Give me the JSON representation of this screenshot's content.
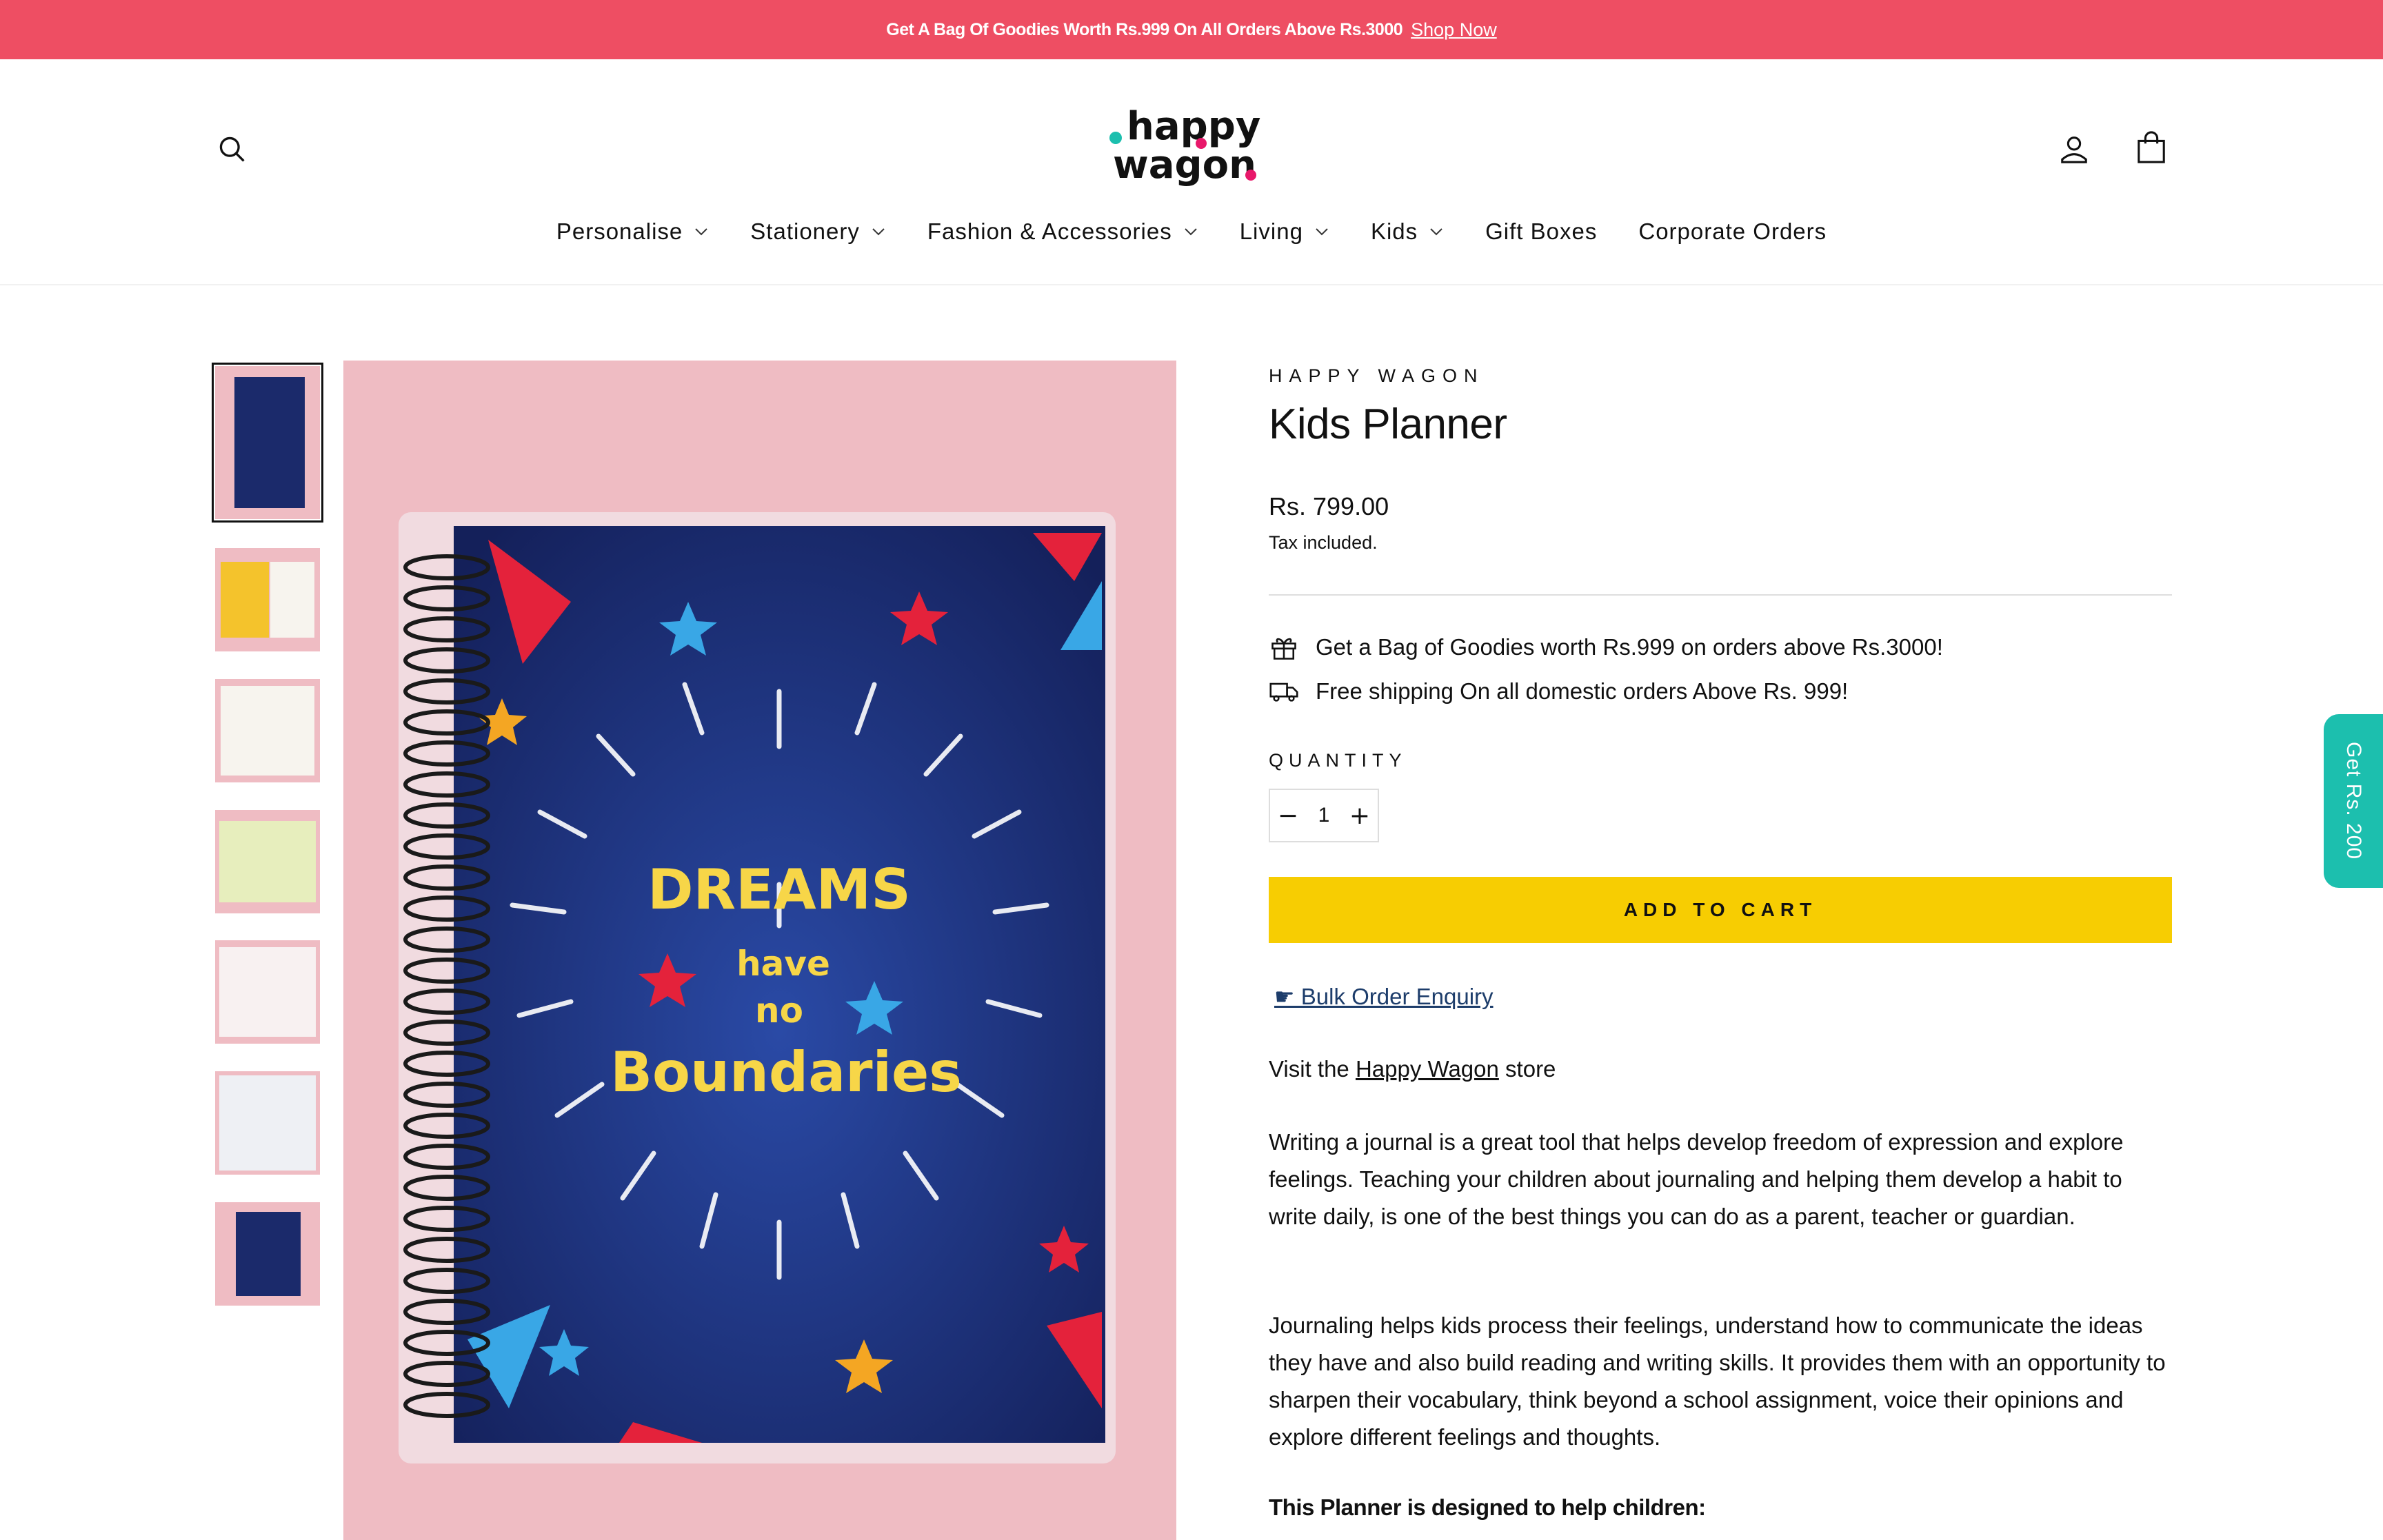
{
  "announcement": {
    "message": "Get A Bag Of Goodies Worth Rs.999 On All Orders Above Rs.3000",
    "link": "Shop Now"
  },
  "header": {
    "logo_line1": "happy",
    "logo_line2": "wagon",
    "icons": {
      "search": "search-icon",
      "account": "user-icon",
      "cart": "cart-icon"
    }
  },
  "nav": [
    {
      "label": "Personalise",
      "dropdown": true
    },
    {
      "label": "Stationery",
      "dropdown": true
    },
    {
      "label": "Fashion & Accessories",
      "dropdown": true
    },
    {
      "label": "Living",
      "dropdown": true
    },
    {
      "label": "Kids",
      "dropdown": true
    },
    {
      "label": "Gift Boxes",
      "dropdown": false
    },
    {
      "label": "Corporate Orders",
      "dropdown": false
    }
  ],
  "product": {
    "vendor": "HAPPY WAGON",
    "title": "Kids Planner",
    "price": "Rs. 799.00",
    "tax_note": "Tax included.",
    "perks": [
      {
        "icon": "gift-icon",
        "text": "Get a Bag of Goodies worth Rs.999 on orders above Rs.3000!"
      },
      {
        "icon": "truck-icon",
        "text": "Free shipping On all domestic orders Above Rs. 999!"
      }
    ],
    "quantity_label": "QUANTITY",
    "quantity_value": "1",
    "add_to_cart": "ADD TO CART",
    "bulk_enquiry": "☛ Bulk Order Enquiry",
    "visit_prefix": "Visit the ",
    "visit_link": "Happy Wagon",
    "visit_suffix": " store",
    "description": [
      "Writing a journal is a great tool that helps develop freedom of expression and explore feelings. Teaching your children about journaling and helping them develop a habit to write daily, is one of the best things you can do as a parent, teacher or guardian.",
      "Journaling helps kids process their feelings, understand how to communicate the ideas they have and also build reading and writing skills. It provides them with an opportunity to sharpen their vocabulary, think beyond a school assignment, voice their opinions and explore different feelings and thoughts."
    ],
    "description_heading": "This Planner is designed to help children:",
    "cover_text": {
      "line1": "DREAMS",
      "line2": "have",
      "line3": "no",
      "line4": "Boundaries"
    }
  },
  "side_tab": "Get Rs. 200",
  "colors": {
    "announcement_bg": "#ee4e63",
    "cta_bg": "#f7cd02",
    "image_bg": "#efbcc3",
    "cover_navy": "#1b2a6b",
    "side_tab_bg": "#1cbfae"
  }
}
